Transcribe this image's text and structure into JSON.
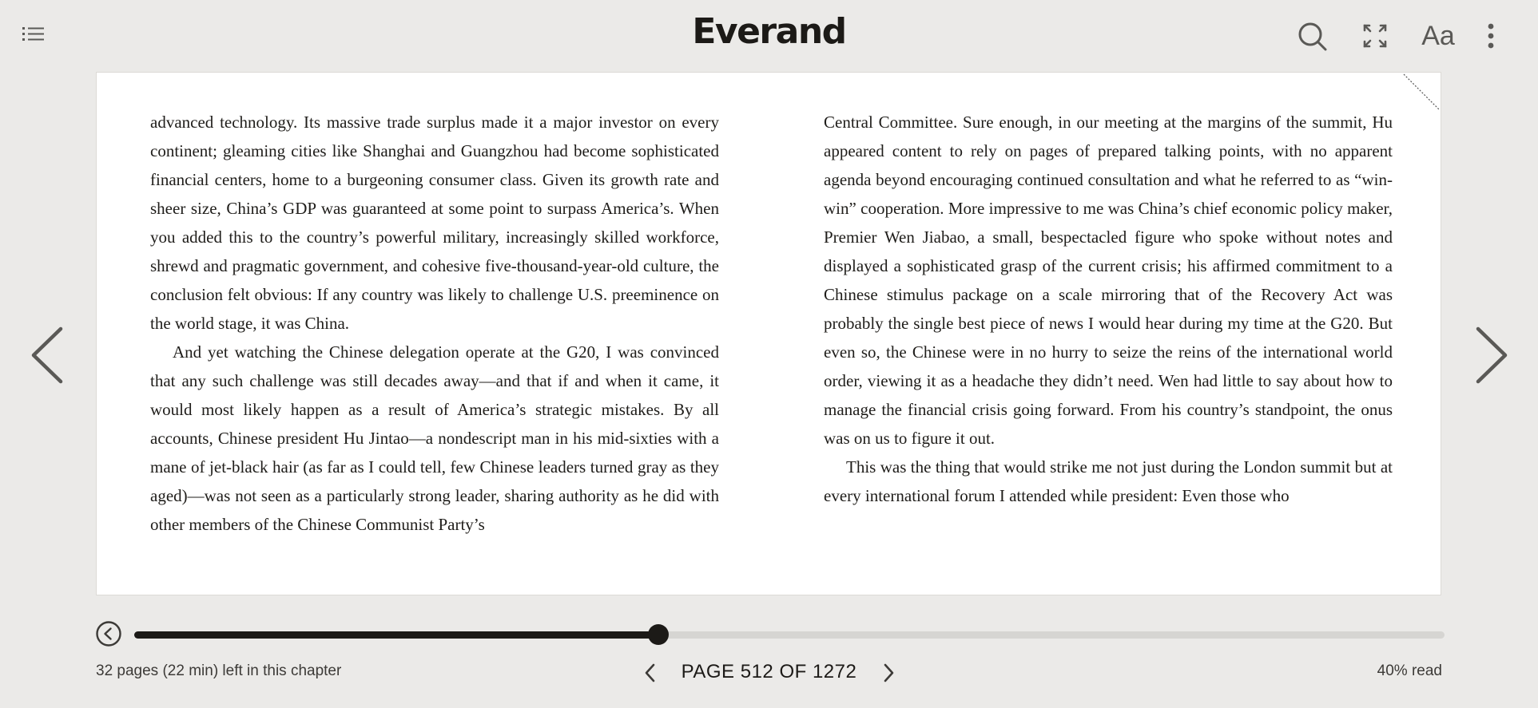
{
  "header": {
    "logo": "Everand",
    "icons": {
      "toc": "list-icon",
      "search": "search-icon",
      "fullscreen": "fullscreen-icon",
      "font": "font-settings-icon",
      "more": "more-vertical-icon"
    },
    "font_label": "Aa"
  },
  "page": {
    "left_paragraphs": [
      "advanced technology. Its massive trade surplus made it a major investor on every continent; gleaming cities like Shanghai and Guangzhou had become sophisticated financial centers, home to a burgeoning consumer class. Given its growth rate and sheer size, China’s GDP was guaranteed at some point to surpass America’s. When you added this to the country’s powerful military, increasingly skilled workforce, shrewd and pragmatic government, and cohesive five-thousand-year-old culture, the conclusion felt obvious: If any country was likely to challenge U.S. preeminence on the world stage, it was China.",
      "And yet watching the Chinese delegation operate at the G20, I was convinced that any such challenge was still decades away—and that if and when it came, it would most likely happen as a result of America’s strategic mistakes. By all accounts, Chinese president Hu Jintao—a nondescript man in his mid-sixties with a mane of jet-black hair (as far as I could tell, few Chinese leaders turned gray as they aged)—was not seen as a particularly strong leader, sharing authority as he did with other members of the Chinese Communist Party’s"
    ],
    "right_paragraphs": [
      "Central Committee. Sure enough, in our meeting at the margins of the summit, Hu appeared content to rely on pages of prepared talking points, with no apparent agenda beyond encouraging continued consultation and what he referred to as “win-win” cooperation. More impressive to me was China’s chief economic policy maker, Premier Wen Jiabao, a small, bespectacled figure who spoke without notes and displayed a sophisticated grasp of the current crisis; his affirmed commitment to a Chinese stimulus package on a scale mirroring that of the Recovery Act was probably the single best piece of news I would hear during my time at the G20. But even so, the Chinese were in no hurry to seize the reins of the international world order, viewing it as a headache they didn’t need. Wen had little to say about how to manage the financial crisis going forward. From his country’s standpoint, the onus was on us to figure it out.",
      "This was the thing that would strike me not just during the London summit but at every international forum I attended while president: Even those who"
    ]
  },
  "navigation": {
    "prev_icon": "chevron-left-icon",
    "next_icon": "chevron-right-icon",
    "back_icon": "circle-back-icon"
  },
  "progress": {
    "fraction": 0.4,
    "chapter_left": "32 pages (22 min) left in this chapter",
    "page_label": "PAGE 512 OF 1272",
    "percent_read": "40% read"
  },
  "colors": {
    "background": "#ebeae8",
    "accent": "#1c1a17",
    "track": "#d6d5d2"
  }
}
